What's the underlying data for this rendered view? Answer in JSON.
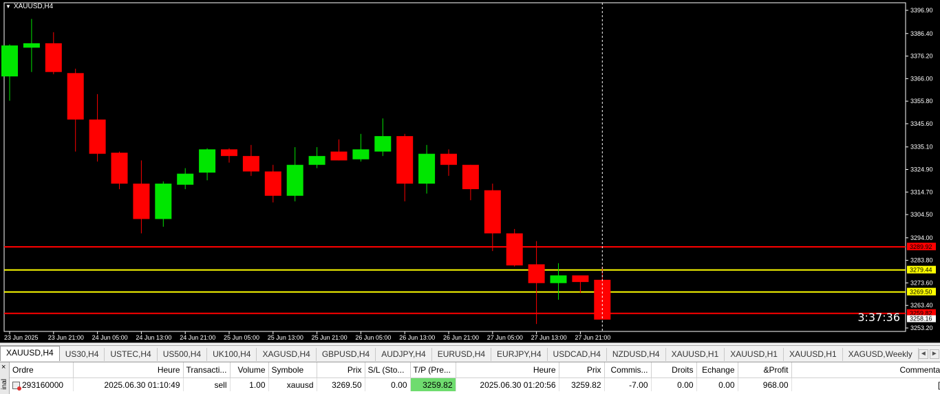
{
  "window": {
    "symbol_title": "XAUUSD,H4",
    "countdown": "3:37:36"
  },
  "colors": {
    "bull": "#00e600",
    "bear": "#ff0000",
    "sl_line": "#ff0000",
    "tp_line": "#ffff00",
    "bg": "#000000",
    "axis_text": "#ffffff"
  },
  "chart_data": {
    "type": "candlestick",
    "ylim": [
      3253.2,
      3396.9
    ],
    "y_ticks": [
      "3396.90",
      "3386.40",
      "3376.20",
      "3366.00",
      "3355.80",
      "3345.60",
      "3335.10",
      "3324.90",
      "3314.70",
      "3304.50",
      "3294.00",
      "3283.80",
      "3273.60",
      "3263.40",
      "3253.20"
    ],
    "x_labels": [
      "23 Jun 2025",
      "23 Jun 21:00",
      "24 Jun 05:00",
      "24 Jun 13:00",
      "24 Jun 21:00",
      "25 Jun 05:00",
      "25 Jun 13:00",
      "25 Jun 21:00",
      "26 Jun 05:00",
      "26 Jun 13:00",
      "26 Jun 21:00",
      "27 Jun 05:00",
      "27 Jun 13:00",
      "27 Jun 21:00"
    ],
    "candles": [
      {
        "o": 3367.0,
        "h": 3381.5,
        "l": 3356.0,
        "c": 3381.0
      },
      {
        "o": 3380.0,
        "h": 3393.0,
        "l": 3369.0,
        "c": 3382.0
      },
      {
        "o": 3382.0,
        "h": 3387.0,
        "l": 3368.0,
        "c": 3369.0
      },
      {
        "o": 3368.5,
        "h": 3370.5,
        "l": 3333.0,
        "c": 3347.5
      },
      {
        "o": 3347.5,
        "h": 3359.0,
        "l": 3328.5,
        "c": 3332.0
      },
      {
        "o": 3332.5,
        "h": 3333.0,
        "l": 3316.0,
        "c": 3318.5
      },
      {
        "o": 3318.5,
        "h": 3329.0,
        "l": 3296.0,
        "c": 3302.5
      },
      {
        "o": 3302.5,
        "h": 3319.5,
        "l": 3299.0,
        "c": 3318.5
      },
      {
        "o": 3318.0,
        "h": 3325.5,
        "l": 3316.0,
        "c": 3323.0
      },
      {
        "o": 3323.5,
        "h": 3334.5,
        "l": 3320.0,
        "c": 3334.0
      },
      {
        "o": 3334.0,
        "h": 3334.5,
        "l": 3328.0,
        "c": 3331.0
      },
      {
        "o": 3331.0,
        "h": 3336.0,
        "l": 3322.0,
        "c": 3324.0
      },
      {
        "o": 3324.0,
        "h": 3327.0,
        "l": 3310.0,
        "c": 3313.0
      },
      {
        "o": 3313.0,
        "h": 3335.0,
        "l": 3310.5,
        "c": 3327.0
      },
      {
        "o": 3327.0,
        "h": 3335.0,
        "l": 3325.5,
        "c": 3331.0
      },
      {
        "o": 3333.0,
        "h": 3338.5,
        "l": 3329.0,
        "c": 3329.0
      },
      {
        "o": 3329.5,
        "h": 3341.0,
        "l": 3328.5,
        "c": 3334.0
      },
      {
        "o": 3333.0,
        "h": 3348.0,
        "l": 3331.0,
        "c": 3340.0
      },
      {
        "o": 3340.0,
        "h": 3341.0,
        "l": 3310.5,
        "c": 3318.5
      },
      {
        "o": 3318.5,
        "h": 3336.0,
        "l": 3314.0,
        "c": 3332.0
      },
      {
        "o": 3332.0,
        "h": 3334.0,
        "l": 3322.0,
        "c": 3327.0
      },
      {
        "o": 3327.0,
        "h": 3327.0,
        "l": 3311.0,
        "c": 3316.0
      },
      {
        "o": 3315.5,
        "h": 3318.5,
        "l": 3288.0,
        "c": 3296.0
      },
      {
        "o": 3296.0,
        "h": 3298.0,
        "l": 3281.0,
        "c": 3281.5
      },
      {
        "o": 3282.0,
        "h": 3292.5,
        "l": 3255.0,
        "c": 3273.5
      },
      {
        "o": 3273.5,
        "h": 3282.5,
        "l": 3266.0,
        "c": 3277.0
      },
      {
        "o": 3277.0,
        "h": 3277.0,
        "l": 3269.0,
        "c": 3274.0
      },
      {
        "o": 3275.0,
        "h": 3281.0,
        "l": 3257.0,
        "c": 3257.0
      }
    ],
    "hlines": [
      {
        "value": 3289.92,
        "label": "3289.92",
        "color": "#ff0000",
        "label_bg": "#ff0000",
        "label_fg": "#000000"
      },
      {
        "value": 3279.44,
        "label": "3279.44",
        "color": "#ffff00",
        "label_bg": "#ffff00",
        "label_fg": "#000000"
      },
      {
        "value": 3269.5,
        "label": "3269.50",
        "color": "#ffff00",
        "label_bg": "#ffff00",
        "label_fg": "#000000"
      },
      {
        "value": 3259.82,
        "label": "3259.82",
        "color": "#ff0000",
        "label_bg": "#ff0000",
        "label_fg": "#000000"
      }
    ],
    "bid_label": "3258.16",
    "bid_value": 3257.4
  },
  "tabs": [
    "XAUUSD,H4",
    "US30,H4",
    "USTEC,H4",
    "US500,H4",
    "UK100,H4",
    "XAGUSD,H4",
    "GBPUSD,H4",
    "AUDJPY,H4",
    "EURUSD,H4",
    "EURJPY,H4",
    "USDCAD,H4",
    "NZDUSD,H4",
    "XAUUSD,H1",
    "XAUUSD,H1",
    "XAUUSD,H1",
    "XAGUSD,Weekly"
  ],
  "terminal": {
    "side_label": "inal",
    "headers": [
      "Ordre",
      "Heure",
      "Transacti...",
      "Volume",
      "Symbole",
      "Prix",
      "S/L (Sto...",
      "T/P (Pre...",
      "Heure",
      "Prix",
      "Commis...",
      "Droits",
      "Echange",
      "&Profit",
      "Commentaire"
    ],
    "row": [
      "293160000",
      "2025.06.30 01:10:49",
      "sell",
      "1.00",
      "xauusd",
      "3269.50",
      "0.00",
      "3259.82",
      "2025.06.30 01:20:56",
      "3259.82",
      "-7.00",
      "0.00",
      "0.00",
      "968.00",
      "[tp]"
    ]
  }
}
